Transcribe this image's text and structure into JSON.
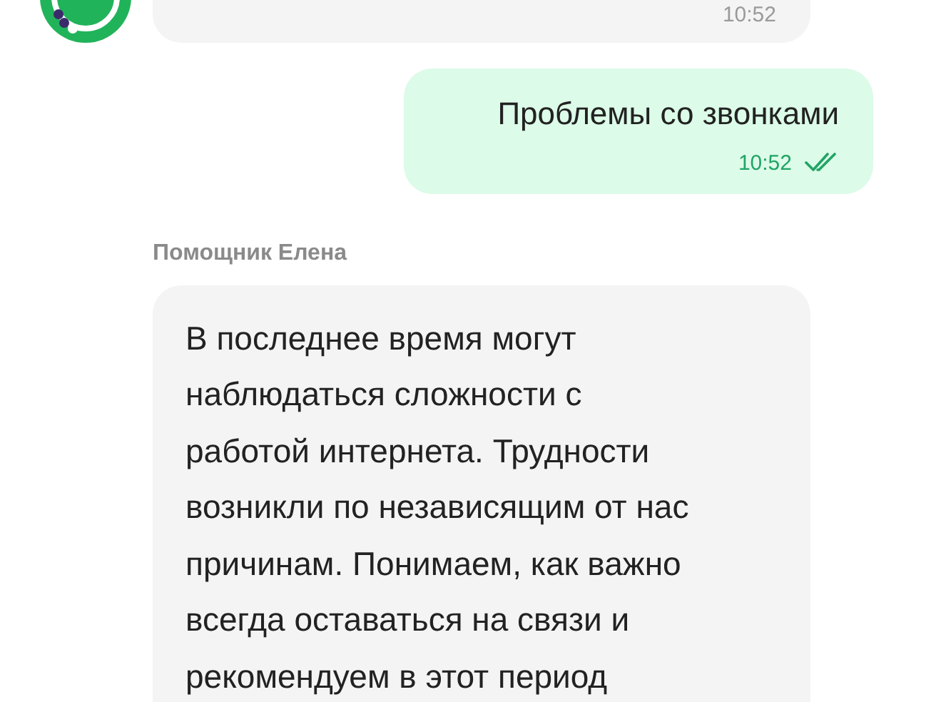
{
  "messages": [
    {
      "kind": "incoming_tail",
      "time": "10:52"
    },
    {
      "kind": "outgoing",
      "text": "Проблемы со звонками",
      "time": "10:52",
      "read": true
    },
    {
      "kind": "incoming",
      "sender": "Помощник Елена",
      "lines": [
        "В последнее время могут",
        "наблюдаться сложности с",
        "работой интернета. Трудности",
        "возникли по независящим от нас",
        "причинам. Понимаем, как важно",
        "всегда оставаться на связи и",
        "рекомендуем в этот период"
      ]
    }
  ]
}
